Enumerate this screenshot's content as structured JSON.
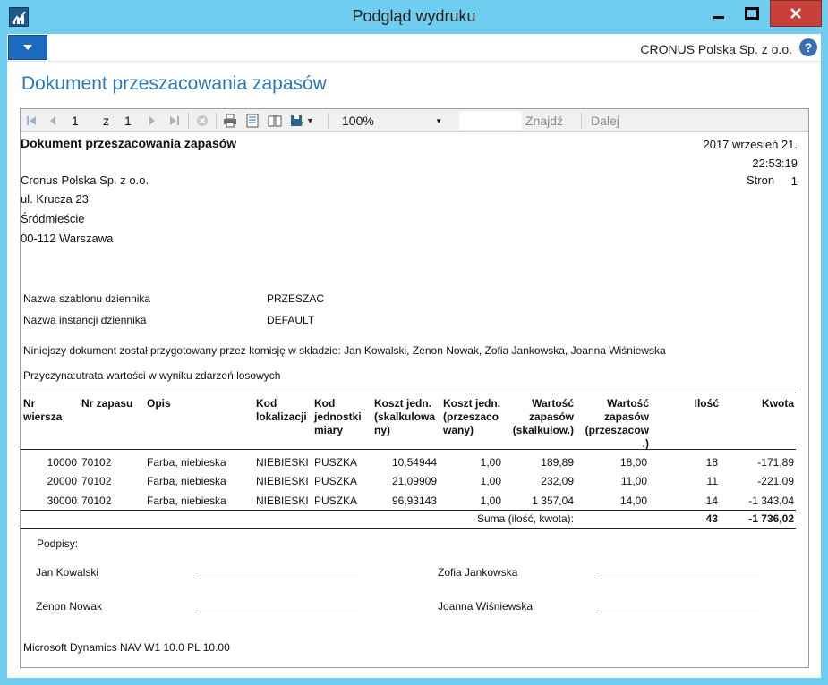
{
  "window": {
    "title": "Podgląd wydruku"
  },
  "ribbon": {
    "company": "CRONUS Polska Sp. z o.o.",
    "help": "?"
  },
  "page_title": "Dokument przeszacowania zapasów",
  "toolbar": {
    "page_current": "1",
    "page_of": "z",
    "page_total": "1",
    "zoom": "100%",
    "find": "Znajdź",
    "next": "Dalej"
  },
  "report": {
    "title": "Dokument przeszacowania zapasów",
    "date": "2017 wrzesień 21.",
    "time": "22:53:19",
    "page_label": "Stron",
    "page_number": "1",
    "address": [
      "Cronus Polska Sp. z o.o.",
      "ul. Krucza 23",
      "Śródmieście",
      "00-112 Warszawa"
    ],
    "journal_template_label": "Nazwa szablonu dziennika",
    "journal_template_value": "PRZESZAC",
    "journal_batch_label": "Nazwa instancji dziennika",
    "journal_batch_value": "DEFAULT",
    "commission_text": "Niniejszy dokument został przygotowany przez komisję w składzie: Jan Kowalski, Zenon Nowak, Zofia Jankowska, Joanna Wiśniewska",
    "reason_text": "Przyczyna:utrata wartości w wyniku zdarzeń losowych",
    "columns": [
      "Nr\nwiersza",
      "Nr zapasu",
      "Opis",
      "Kod\nlokalizacji",
      "Kod\njednostki\nmiary",
      "Koszt jedn.\n(skalkulowa\nny)",
      "Koszt jedn.\n(przeszaco\nwany)",
      "Wartość\nzapasów\n(skalkulow.)",
      "Wartość\nzapasów\n(przeszacow\n.)",
      "Ilość",
      "Kwota"
    ],
    "rows": [
      [
        "10000",
        "70102",
        "Farba, niebieska",
        "NIEBIESKI",
        "PUSZKA",
        "10,54944",
        "1,00",
        "189,89",
        "18,00",
        "18",
        "-171,89"
      ],
      [
        "20000",
        "70102",
        "Farba, niebieska",
        "NIEBIESKI",
        "PUSZKA",
        "21,09909",
        "1,00",
        "232,09",
        "11,00",
        "11",
        "-221,09"
      ],
      [
        "30000",
        "70102",
        "Farba, niebieska",
        "NIEBIESKI",
        "PUSZKA",
        "96,93143",
        "1,00",
        "1 357,04",
        "14,00",
        "14",
        "-1 343,04"
      ]
    ],
    "total_label": "Suma (ilość, kwota):",
    "total_qty": "43",
    "total_amount": "-1 736,02",
    "signatures_label": "Podpisy:",
    "signers": [
      "Jan Kowalski",
      "Zenon Nowak",
      "Zofia Jankowska",
      "Joanna Wiśniewska"
    ],
    "footer": "Microsoft Dynamics NAV W1 10.0  PL 10.00"
  }
}
